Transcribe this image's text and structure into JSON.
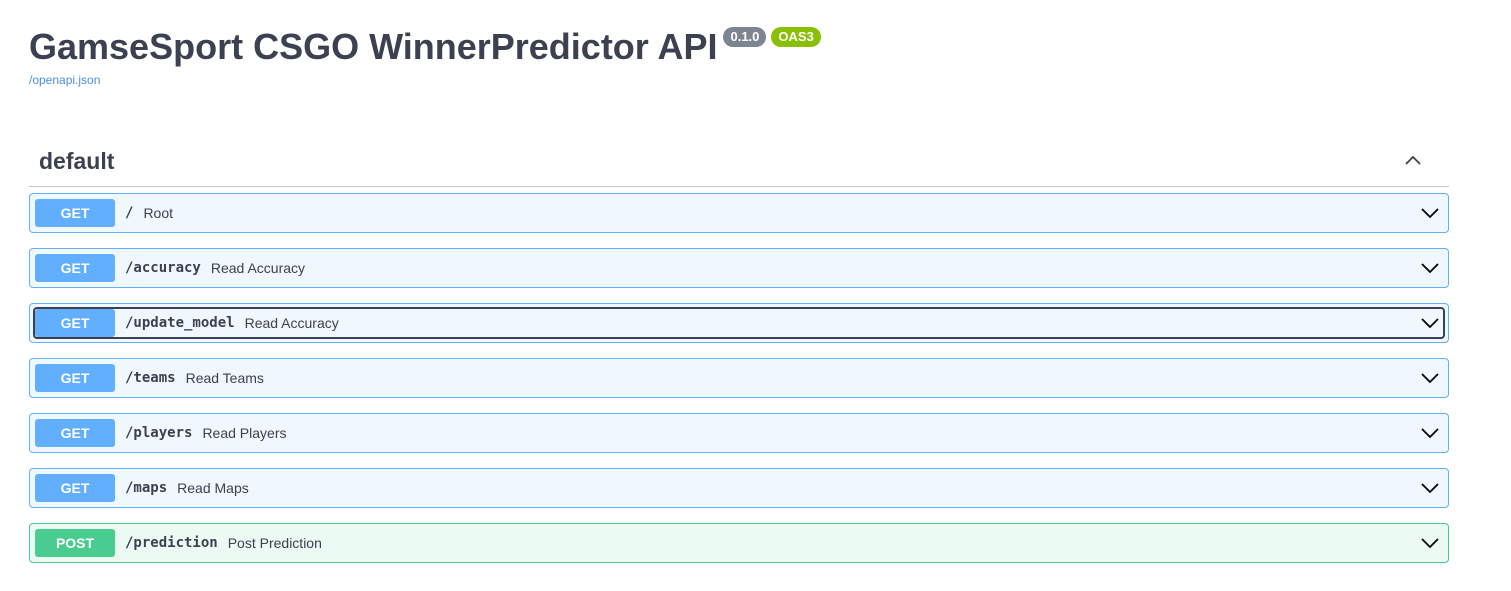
{
  "info": {
    "title": "GamseSport CSGO WinnerPredictor API",
    "version": "0.1.0",
    "oas": "OAS3",
    "spec_link": "/openapi.json"
  },
  "section": {
    "title": "default",
    "collapse_icon": "chevron-up-icon"
  },
  "operations": [
    {
      "method": "GET",
      "path": "/",
      "summary": "Root"
    },
    {
      "method": "GET",
      "path": "/accuracy",
      "summary": "Read Accuracy"
    },
    {
      "method": "GET",
      "path": "/update_model",
      "summary": "Read Accuracy"
    },
    {
      "method": "GET",
      "path": "/teams",
      "summary": "Read Teams"
    },
    {
      "method": "GET",
      "path": "/players",
      "summary": "Read Players"
    },
    {
      "method": "GET",
      "path": "/maps",
      "summary": "Read Maps"
    },
    {
      "method": "POST",
      "path": "/prediction",
      "summary": "Post Prediction"
    }
  ],
  "colors": {
    "get": "#61affe",
    "post": "#49cc90",
    "version_badge": "#7d8492",
    "oas_badge": "#89bf04",
    "link": "#4990e2",
    "text": "#3b4151"
  }
}
